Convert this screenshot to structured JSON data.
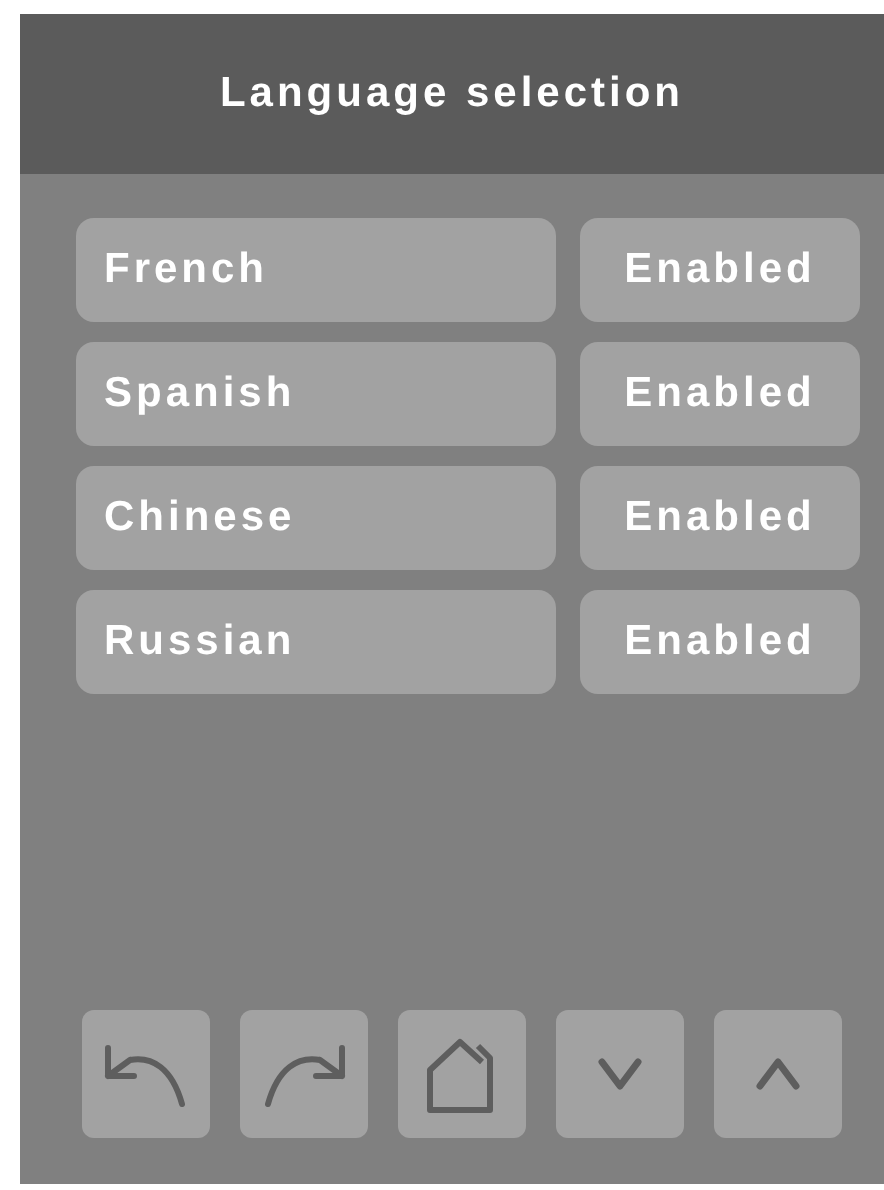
{
  "header": {
    "title": "Language selection"
  },
  "languages": [
    {
      "name": "French",
      "status": "Enabled"
    },
    {
      "name": "Spanish",
      "status": "Enabled"
    },
    {
      "name": "Chinese",
      "status": "Enabled"
    },
    {
      "name": "Russian",
      "status": "Enabled"
    }
  ],
  "nav_buttons": [
    {
      "kind": "back"
    },
    {
      "kind": "forward"
    },
    {
      "kind": "home"
    },
    {
      "kind": "down"
    },
    {
      "kind": "up"
    }
  ]
}
